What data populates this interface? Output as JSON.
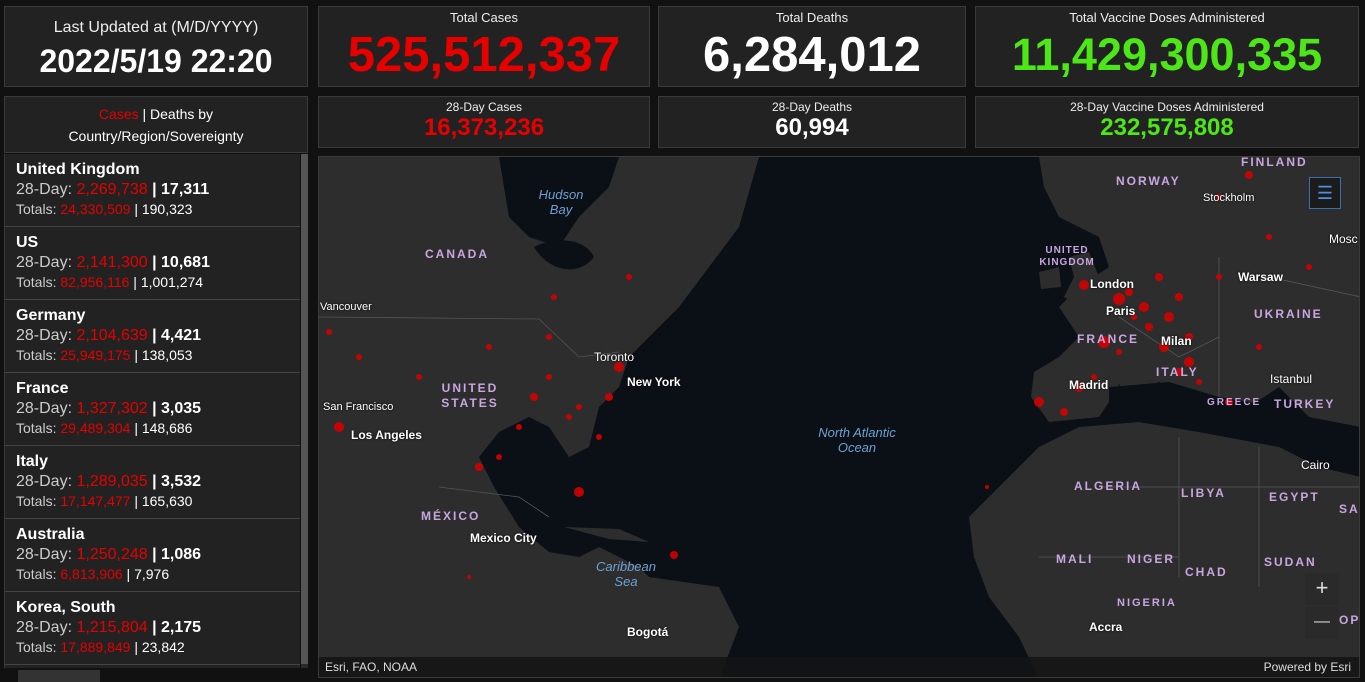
{
  "last_updated": {
    "label": "Last Updated at (M/D/YYYY)",
    "value": "2022/5/19 22:20"
  },
  "totals": {
    "cases": {
      "label": "Total Cases",
      "value": "525,512,337"
    },
    "deaths": {
      "label": "Total Deaths",
      "value": "6,284,012"
    },
    "vaccines": {
      "label": "Total Vaccine Doses Administered",
      "value": "11,429,300,335"
    }
  },
  "day28": {
    "cases": {
      "label": "28-Day Cases",
      "value": "16,373,236"
    },
    "deaths": {
      "label": "28-Day Deaths",
      "value": "60,994"
    },
    "vaccines": {
      "label": "28-Day Vaccine Doses Administered",
      "value": "232,575,808"
    }
  },
  "list": {
    "title_cases": "Cases",
    "title_rest": " | Deaths by",
    "title_line2": "Country/Region/Sovereignty",
    "row1_prefix": "28-Day: ",
    "row2_prefix": "Totals: ",
    "items": [
      {
        "name": "United Kingdom",
        "c28": "2,269,738",
        "d28": "17,311",
        "ct": "24,330,509",
        "dt": "190,323"
      },
      {
        "name": "US",
        "c28": "2,141,300",
        "d28": "10,681",
        "ct": "82,956,116",
        "dt": "1,001,274"
      },
      {
        "name": "Germany",
        "c28": "2,104,639",
        "d28": "4,421",
        "ct": "25,949,175",
        "dt": "138,053"
      },
      {
        "name": "France",
        "c28": "1,327,302",
        "d28": "3,035",
        "ct": "29,489,304",
        "dt": "148,686"
      },
      {
        "name": "Italy",
        "c28": "1,289,035",
        "d28": "3,532",
        "ct": "17,147,477",
        "dt": "165,630"
      },
      {
        "name": "Australia",
        "c28": "1,250,248",
        "d28": "1,086",
        "ct": "6,813,906",
        "dt": "7,976"
      },
      {
        "name": "Korea, South",
        "c28": "1,215,804",
        "d28": "2,175",
        "ct": "17,889,849",
        "dt": "23,842"
      }
    ]
  },
  "map": {
    "countries": [
      "CANADA",
      "UNITED STATES",
      "MÉXICO",
      "NORWAY",
      "FINLAND",
      "UNITED KINGDOM",
      "FRANCE",
      "ITALY",
      "UKRAINE",
      "GREECE",
      "TURKEY",
      "ALGERIA",
      "LIBYA",
      "EGYPT",
      "MALI",
      "NIGER",
      "CHAD",
      "SUDAN",
      "NIGERIA",
      "SA",
      "OP"
    ],
    "oceans": [
      "Hudson Bay",
      "North Atlantic Ocean",
      "Caribbean Sea"
    ],
    "cities": [
      "Vancouver",
      "Toronto",
      "New York",
      "San Francisco",
      "Los Angeles",
      "Mexico City",
      "Bogotá",
      "London",
      "Paris",
      "Milan",
      "Madrid",
      "Warsaw",
      "Stockholm",
      "Mosc",
      "Istanbul",
      "Cairo",
      "Accra"
    ],
    "attribution_left": "Esri, FAO, NOAA",
    "attribution_right": "Powered by Esri",
    "zoom_in": "+",
    "zoom_out": "—",
    "legend_icon": "list-icon"
  },
  "colors": {
    "cases": "#e60000",
    "deaths": "#ffffff",
    "vaccines": "#4de617",
    "panel": "#222222"
  }
}
